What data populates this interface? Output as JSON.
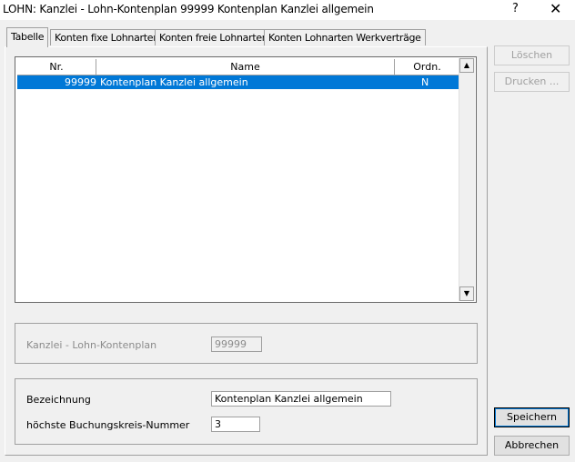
{
  "window": {
    "title": "LOHN: Kanzlei - Lohn-Kontenplan  99999  Kontenplan Kanzlei allgemein",
    "help_label": "?",
    "close_label": "✕"
  },
  "tabs": [
    {
      "label": "Tabelle"
    },
    {
      "label": "Konten fixe Lohnarten"
    },
    {
      "label": "Konten freie Lohnarten"
    },
    {
      "label": "Konten Lohnarten Werkverträge"
    }
  ],
  "table": {
    "columns": [
      "Nr.",
      "Name",
      "Ordn."
    ],
    "rows": [
      {
        "nr": "99999",
        "name": "Kontenplan Kanzlei allgemein",
        "ordn": "N"
      }
    ]
  },
  "kontenplan": {
    "label": "Kanzlei - Lohn-Kontenplan",
    "value": "99999"
  },
  "details": {
    "bezeichnung_label": "Bezeichnung",
    "bezeichnung_value": "Kontenplan Kanzlei allgemein",
    "buchungskreis_label": "höchste Buchungskreis-Nummer",
    "buchungskreis_value": "3"
  },
  "buttons": {
    "loeschen": "Löschen",
    "drucken": "Drucken ...",
    "speichern": "Speichern",
    "abbrechen": "Abbrechen"
  },
  "icons": {
    "scroll_up": "▲",
    "scroll_down": "▼"
  }
}
